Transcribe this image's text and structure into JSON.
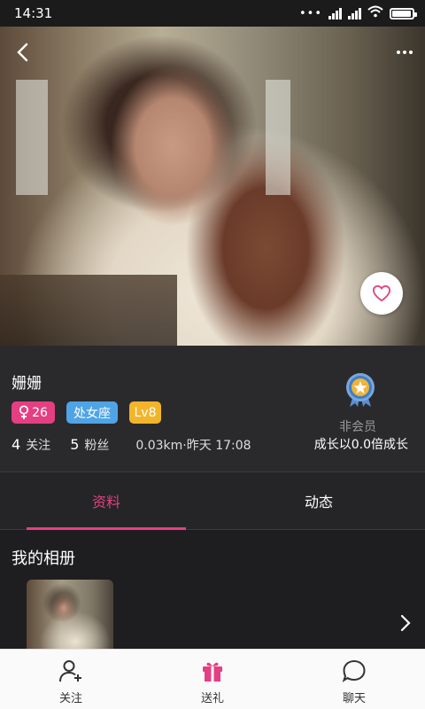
{
  "status_bar": {
    "time": "14:31",
    "battery_level": 0.95
  },
  "hero": {
    "photo_description_icon": "profile-photo"
  },
  "profile": {
    "name": "姗姗",
    "age": "26",
    "zodiac": "处女座",
    "level": "Lv8",
    "following_count": "4",
    "following_label": "关注",
    "followers_count": "5",
    "followers_label": "粉丝",
    "distance_time": "0.03km·昨天 17:08",
    "member_status": "非会员",
    "growth_text": "成长以0.0倍成长"
  },
  "tabs": [
    {
      "label": "资料",
      "active": true
    },
    {
      "label": "动态",
      "active": false
    }
  ],
  "album": {
    "title": "我的相册"
  },
  "bottom_nav": [
    {
      "label": "关注",
      "icon": "add-user-icon"
    },
    {
      "label": "送礼",
      "icon": "gift-icon"
    },
    {
      "label": "聊天",
      "icon": "chat-bubble-icon"
    }
  ],
  "colors": {
    "accent": "#e43f83",
    "zodiac_tag": "#4fa4e6",
    "level_tag": "#f2b52a",
    "medal": "#3e7fc4"
  }
}
